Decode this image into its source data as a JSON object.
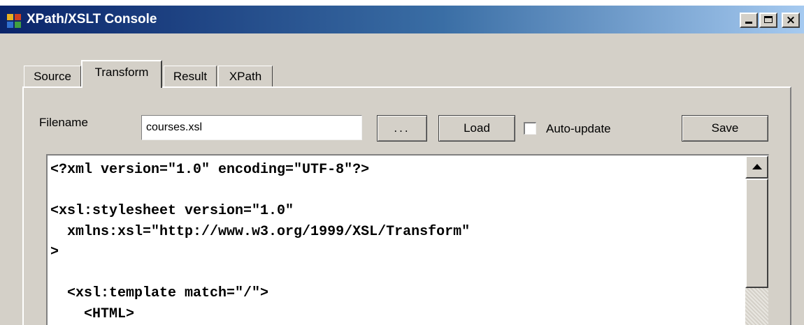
{
  "window": {
    "title": "XPath/XSLT Console",
    "icon": "app-window-icon",
    "controls": {
      "minimize": "minimize-icon",
      "maximize": "maximize-icon",
      "close": "×"
    }
  },
  "tabs": [
    {
      "label": "Source",
      "active": false
    },
    {
      "label": "Transform",
      "active": true
    },
    {
      "label": "Result",
      "active": false
    },
    {
      "label": "XPath",
      "active": false
    }
  ],
  "form": {
    "filename_label": "Filename",
    "filename_value": "courses.xsl",
    "browse_label": "...",
    "load_label": "Load",
    "auto_update_label": "Auto-update",
    "auto_update_checked": false,
    "save_label": "Save"
  },
  "editor": {
    "lines": [
      "<?xml version=\"1.0\" encoding=\"UTF-8\"?>",
      "",
      "<xsl:stylesheet version=\"1.0\"",
      "  xmlns:xsl=\"http://www.w3.org/1999/XSL/Transform\"",
      ">",
      "",
      "  <xsl:template match=\"/\">",
      "    <HTML>"
    ]
  },
  "colors": {
    "title_gradient_start": "#0a246a",
    "title_gradient_end": "#a6caf0",
    "face": "#d4d0c8"
  }
}
